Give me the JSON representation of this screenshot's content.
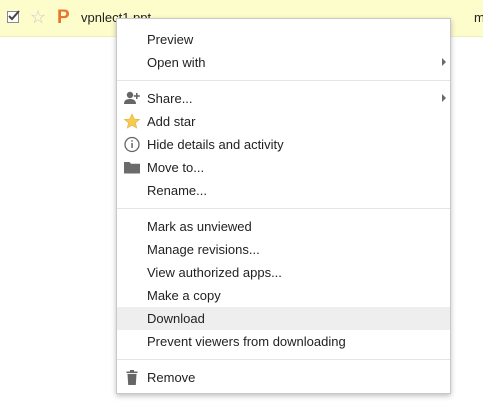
{
  "file_row": {
    "file_name": "vpnlect1.ppt",
    "owner_truncated": "m",
    "file_type_letter": "P",
    "colors": {
      "row_highlight": "#fdfccb",
      "ppt_icon": "#e8762d"
    },
    "icons": {
      "checkbox": "checkbox-checked-icon",
      "star": "star-outline-icon",
      "file_type": "powerpoint-file-icon"
    }
  },
  "context_menu": {
    "group1": [
      {
        "label": "Preview"
      },
      {
        "label": "Open with",
        "submenu": true
      }
    ],
    "group2": [
      {
        "label": "Share...",
        "icon": "share-person-add-icon",
        "submenu": true
      },
      {
        "label": "Add star",
        "icon": "star-icon"
      },
      {
        "label": "Hide details and activity",
        "icon": "info-icon"
      },
      {
        "label": "Move to...",
        "icon": "folder-icon"
      },
      {
        "label": "Rename..."
      }
    ],
    "group3": [
      {
        "label": "Mark as unviewed"
      },
      {
        "label": "Manage revisions..."
      },
      {
        "label": "View authorized apps..."
      },
      {
        "label": "Make a copy"
      },
      {
        "label": "Download",
        "highlighted": true
      },
      {
        "label": "Prevent viewers from downloading"
      }
    ],
    "group4": [
      {
        "label": "Remove",
        "icon": "trash-icon"
      }
    ],
    "colors": {
      "hover_background": "#eeeeee",
      "star_icon": "#f7cb4d"
    }
  }
}
